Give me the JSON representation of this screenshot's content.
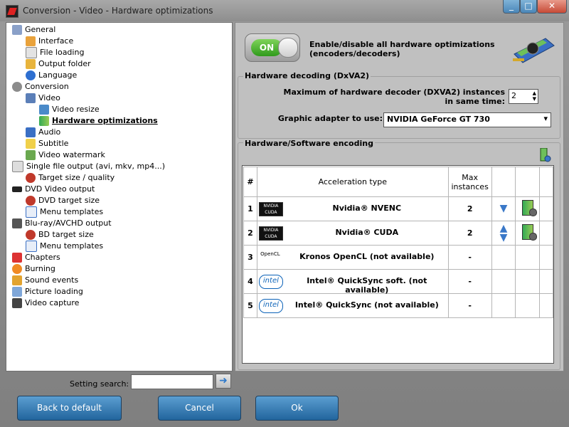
{
  "window": {
    "title": "Conversion - Video - Hardware optimizations",
    "controls": [
      "_",
      "□",
      "✕"
    ]
  },
  "sidebar": {
    "items": [
      {
        "label": "General",
        "icon": "wrench-icon"
      },
      {
        "label": "Interface",
        "icon": "paint-icon"
      },
      {
        "label": "File loading",
        "icon": "file-icon"
      },
      {
        "label": "Output folder",
        "icon": "folder-icon"
      },
      {
        "label": "Language",
        "icon": "globe-icon"
      },
      {
        "label": "Conversion",
        "icon": "gear-icon"
      },
      {
        "label": "Video",
        "icon": "filmstrip-icon"
      },
      {
        "label": "Video resize",
        "icon": "resize-icon"
      },
      {
        "label": "Hardware optimizations",
        "icon": "gpu-icon"
      },
      {
        "label": "Audio",
        "icon": "music-note-icon"
      },
      {
        "label": "Subtitle",
        "icon": "subtitle-icon"
      },
      {
        "label": "Video watermark",
        "icon": "image-icon"
      },
      {
        "label": "Single file output (avi, mkv, mp4...)",
        "icon": "page-icon"
      },
      {
        "label": "Target size / quality",
        "icon": "target-icon"
      },
      {
        "label": "DVD Video output",
        "icon": "dvd-icon"
      },
      {
        "label": "DVD target size",
        "icon": "target-icon"
      },
      {
        "label": "Menu templates",
        "icon": "menu-list-icon"
      },
      {
        "label": "Blu-ray/AVCHD output",
        "icon": "hd-icon"
      },
      {
        "label": "BD target size",
        "icon": "target-icon"
      },
      {
        "label": "Menu templates",
        "icon": "menu-list-icon"
      },
      {
        "label": "Chapters",
        "icon": "flag-icon"
      },
      {
        "label": "Burning",
        "icon": "flame-icon"
      },
      {
        "label": "Sound events",
        "icon": "speaker-icon"
      },
      {
        "label": "Picture loading",
        "icon": "picture-icon"
      },
      {
        "label": "Video capture",
        "icon": "camera-icon"
      }
    ]
  },
  "toggle": {
    "state": "ON",
    "label": "Enable/disable all hardware optimizations (encoders/decoders)"
  },
  "decoding": {
    "title": "Hardware decoding (DxVA2)",
    "max_label": "Maximum of hardware decoder (DXVA2) instances in same time:",
    "max_value": "2",
    "adapter_label": "Graphic adapter to use:",
    "adapter_value": "NVIDIA GeForce GT 730"
  },
  "encoding": {
    "title": "Hardware/Software encoding",
    "headers": {
      "num": "#",
      "type": "Acceleration type",
      "max": "Max instances"
    },
    "rows": [
      {
        "num": "1",
        "badge": "nvidia",
        "badge_text": "NVIDIA CUDA",
        "type": "Nvidia® NVENC",
        "max": "2",
        "arrows": "down"
      },
      {
        "num": "2",
        "badge": "nvidia",
        "badge_text": "NVIDIA CUDA",
        "type": "Nvidia® CUDA",
        "max": "2",
        "arrows": "up-down"
      },
      {
        "num": "3",
        "badge": "opencl",
        "badge_text": "OpenCL",
        "type": "Kronos OpenCL (not available)",
        "max": "-",
        "arrows": ""
      },
      {
        "num": "4",
        "badge": "intel",
        "badge_text": "intel",
        "type": "Intel® QuickSync soft. (not available)",
        "max": "-",
        "arrows": ""
      },
      {
        "num": "5",
        "badge": "intel",
        "badge_text": "intel",
        "type": "Intel® QuickSync (not available)",
        "max": "-",
        "arrows": ""
      }
    ]
  },
  "search": {
    "label": "Setting search:",
    "value": ""
  },
  "buttons": {
    "back": "Back to default",
    "cancel": "Cancel",
    "ok": "Ok"
  },
  "colors": {
    "accent": "#2f6fa8",
    "toggle_on": "#3ca825"
  }
}
